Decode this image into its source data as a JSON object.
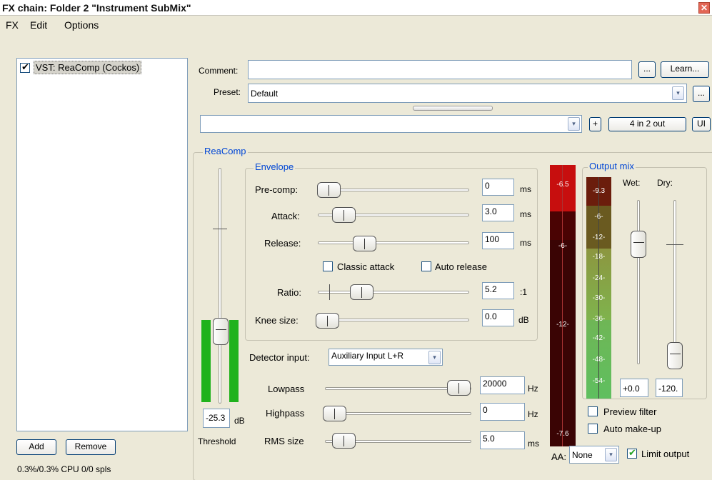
{
  "window": {
    "title": "FX chain: Folder 2 \"Instrument SubMix\""
  },
  "menu": {
    "fx": "FX",
    "edit": "Edit",
    "options": "Options"
  },
  "fxlist": {
    "items": [
      {
        "label": "VST: ReaComp (Cockos)",
        "enabled": true
      }
    ]
  },
  "bottom": {
    "add": "Add",
    "remove": "Remove",
    "cpu": "0.3%/0.3% CPU 0/0 spls"
  },
  "header": {
    "comment_label": "Comment:",
    "comment_value": "",
    "comment_more": "...",
    "learn": "Learn...",
    "preset_label": "Preset:",
    "preset_value": "Default",
    "preset_more": "...",
    "preset_dd": "▾",
    "io_value": "",
    "io_dd": "▾",
    "plus": "+",
    "routing": "4 in 2 out",
    "ui": "UI"
  },
  "plugin": {
    "name": "ReaComp",
    "threshold": {
      "value": "-25.3",
      "unit": "dB",
      "label": "Threshold"
    },
    "envelope": {
      "title": "Envelope",
      "precomp": {
        "label": "Pre-comp:",
        "value": "0",
        "unit": "ms"
      },
      "attack": {
        "label": "Attack:",
        "value": "3.0",
        "unit": "ms"
      },
      "release": {
        "label": "Release:",
        "value": "100",
        "unit": "ms"
      },
      "classic_attack": {
        "label": "Classic attack",
        "checked": false
      },
      "auto_release": {
        "label": "Auto release",
        "checked": false
      },
      "ratio": {
        "label": "Ratio:",
        "value": "5.2",
        "unit": ":1"
      },
      "knee": {
        "label": "Knee size:",
        "value": "0.0",
        "unit": "dB"
      }
    },
    "detector": {
      "label": "Detector input:",
      "value": "Auxiliary Input L+R",
      "dd": "▾"
    },
    "lowpass": {
      "label": "Lowpass",
      "value": "20000",
      "unit": "Hz"
    },
    "highpass": {
      "label": "Highpass",
      "value": "0",
      "unit": "Hz"
    },
    "rms": {
      "label": "RMS size",
      "value": "5.0",
      "unit": "ms"
    },
    "gr_meter": {
      "top": "-6.5",
      "mid1": "-6-",
      "mid2": "-12-",
      "bottom": "-7.6"
    },
    "output_mix": {
      "title": "Output mix",
      "wet_label": "Wet:",
      "dry_label": "Dry:",
      "wet_value": "+0.0",
      "dry_value": "-120.",
      "meter_labels": [
        "-9.3",
        "-6-",
        "-12-",
        "-18-",
        "-24-",
        "-30-",
        "-36-",
        "-42-",
        "-48-",
        "-54-"
      ]
    },
    "preview_filter": {
      "label": "Preview filter",
      "checked": false
    },
    "auto_makeup": {
      "label": "Auto make-up",
      "checked": false
    },
    "aa": {
      "label": "AA:",
      "value": "None",
      "dd": "▾"
    },
    "limit_output": {
      "label": "Limit output",
      "checked": true
    }
  }
}
